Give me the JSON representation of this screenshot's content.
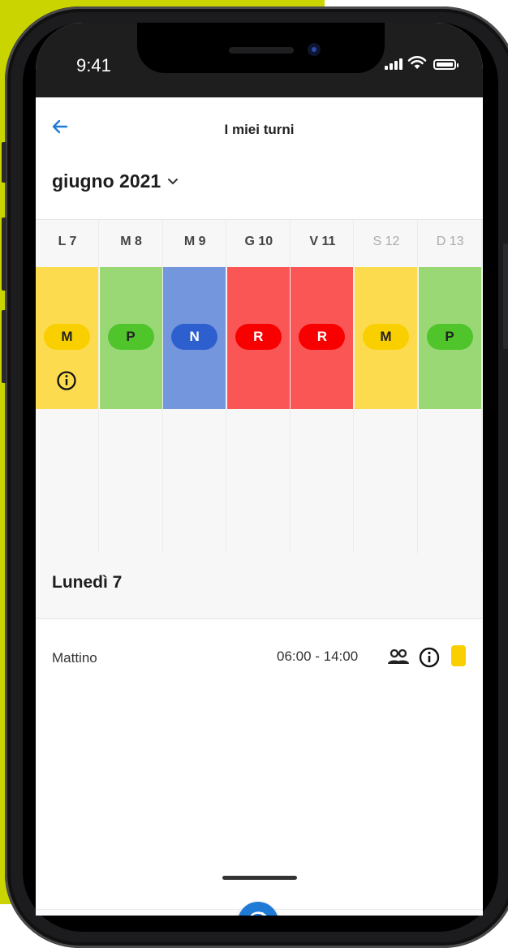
{
  "status_bar": {
    "time": "9:41"
  },
  "header": {
    "title": "I miei turni"
  },
  "month_selector": {
    "label": "giugno 2021"
  },
  "days": [
    {
      "label": "L 7",
      "weekend": false,
      "shift_code": "M",
      "shift_color": "#fddb4f",
      "pill_color": "#f9cf00",
      "pill_text_color": "#222222",
      "has_info": true
    },
    {
      "label": "M 8",
      "weekend": false,
      "shift_code": "P",
      "shift_color": "#9ad876",
      "pill_color": "#4fc42b",
      "pill_text_color": "#222222",
      "has_info": false
    },
    {
      "label": "M 9",
      "weekend": false,
      "shift_code": "N",
      "shift_color": "#7496dc",
      "pill_color": "#2e5fce",
      "pill_text_color": "#ffffff",
      "has_info": false
    },
    {
      "label": "G 10",
      "weekend": false,
      "shift_code": "R",
      "shift_color": "#fb5656",
      "pill_color": "#f80000",
      "pill_text_color": "#ffffff",
      "has_info": false
    },
    {
      "label": "V 11",
      "weekend": false,
      "shift_code": "R",
      "shift_color": "#fb5656",
      "pill_color": "#f80000",
      "pill_text_color": "#ffffff",
      "has_info": false
    },
    {
      "label": "S 12",
      "weekend": true,
      "shift_code": "M",
      "shift_color": "#fddb4f",
      "pill_color": "#f9cf00",
      "pill_text_color": "#222222",
      "has_info": false
    },
    {
      "label": "D 13",
      "weekend": true,
      "shift_code": "P",
      "shift_color": "#9ad876",
      "pill_color": "#4fc42b",
      "pill_text_color": "#222222",
      "has_info": false
    }
  ],
  "selected_day": {
    "title": "Lunedì 7",
    "shifts": [
      {
        "name": "Mattino",
        "time": "06:00 - 14:00",
        "badge_color": "#f9cf00"
      }
    ]
  },
  "bottom_nav": {
    "items": [
      {
        "icon": "calendar-icon",
        "active": true
      },
      {
        "icon": "user-sync-icon",
        "active": false
      },
      {
        "icon": "swap-arrows-icon",
        "active": false
      },
      {
        "icon": "menu-icon",
        "active": false
      }
    ]
  },
  "colors": {
    "accent": "#1f7ad6",
    "background_left": "#c9d400"
  }
}
